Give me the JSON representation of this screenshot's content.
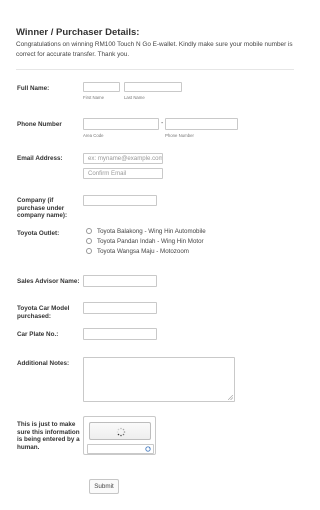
{
  "header": {
    "title": "Winner / Purchaser Details:",
    "intro": "Congratulations on winning RM100 Touch N Go E-wallet. Kindly make sure your mobile number is correct for accurate transfer. Thank you."
  },
  "fields": {
    "full_name": {
      "label": "Full Name:",
      "first_sub": "First Name",
      "last_sub": "Last Name",
      "first_value": "",
      "last_value": ""
    },
    "phone": {
      "label": "Phone Number",
      "area_sub": "Area Code",
      "number_sub": "Phone Number",
      "separator": "-",
      "area_value": "",
      "number_value": ""
    },
    "email": {
      "label": "Email Address:",
      "placeholder": "ex: myname@example.com",
      "confirm_placeholder": "Confirm Email"
    },
    "company": {
      "label_line1": "Company (if",
      "label_line2": "purchase under",
      "label_line3": "company name):",
      "value": ""
    },
    "outlet": {
      "label": "Toyota Outlet:",
      "options": [
        "Toyota Balakong - Wing Hin Automobile",
        "Toyota Pandan Indah - Wing Hin Motor",
        "Toyota Wangsa Maju - Motozoom"
      ]
    },
    "sales_advisor": {
      "label": "Sales Advisor Name:",
      "value": ""
    },
    "car_model": {
      "label_line1": "Toyota Car Model",
      "label_line2": "purchased:",
      "value": ""
    },
    "car_plate": {
      "label": "Car Plate No.:",
      "value": ""
    },
    "notes": {
      "label": "Additional Notes:",
      "value": ""
    },
    "captcha": {
      "label_line1": "This is just to make",
      "label_line2": "sure this information",
      "label_line3": "is being entered by a",
      "label_line4": "human.",
      "value": ""
    }
  },
  "actions": {
    "submit_label": "Submit"
  },
  "colors": {
    "border": "#c9c9c9",
    "text": "#333333",
    "divider": "#e6e6e6"
  }
}
